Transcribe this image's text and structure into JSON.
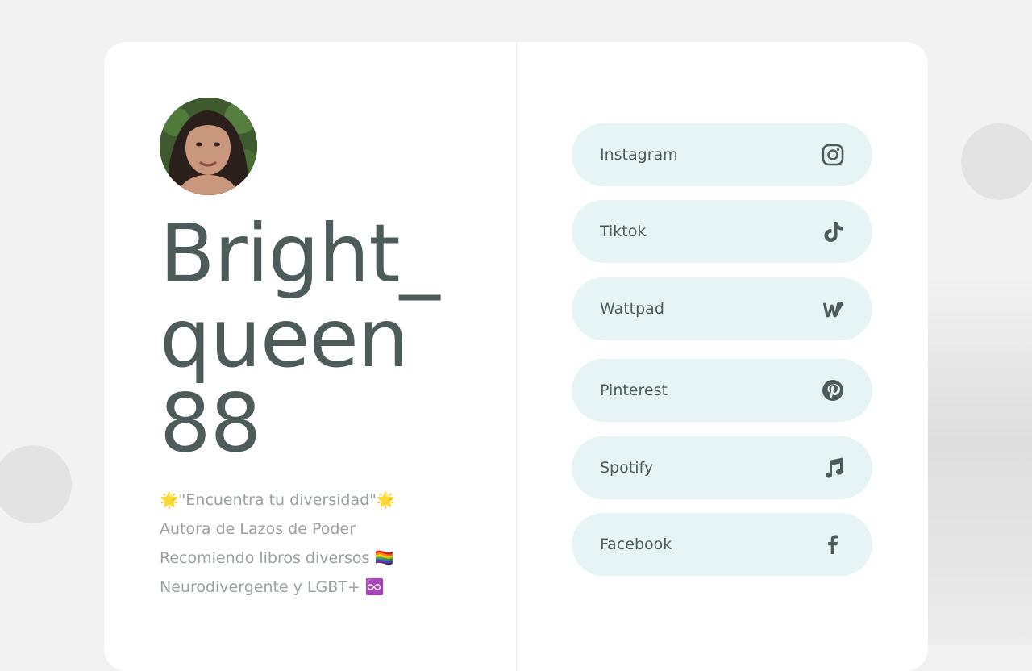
{
  "profile": {
    "name_lines": [
      "Bright_",
      "queen",
      "88"
    ],
    "bio_lines": [
      "🌟\"Encuentra tu diversidad\"🌟",
      "Autora de Lazos de Poder",
      "Recomiendo libros diversos 🏳️‍🌈",
      "Neurodivergente y LGBT+ ♾️"
    ]
  },
  "links": [
    {
      "label": "Instagram",
      "icon": "instagram-icon"
    },
    {
      "label": "Tiktok",
      "icon": "tiktok-icon"
    },
    {
      "label": "Wattpad",
      "icon": "wattpad-icon"
    },
    {
      "label": "Pinterest",
      "icon": "pinterest-icon"
    },
    {
      "label": "Spotify",
      "icon": "music-note-icon"
    },
    {
      "label": "Facebook",
      "icon": "facebook-icon"
    }
  ],
  "colors": {
    "background": "#f2f2f2",
    "card": "#ffffff",
    "link_background": "#e6f4f5",
    "text_primary": "#4e5b5b",
    "text_secondary": "#9aa0a1"
  }
}
